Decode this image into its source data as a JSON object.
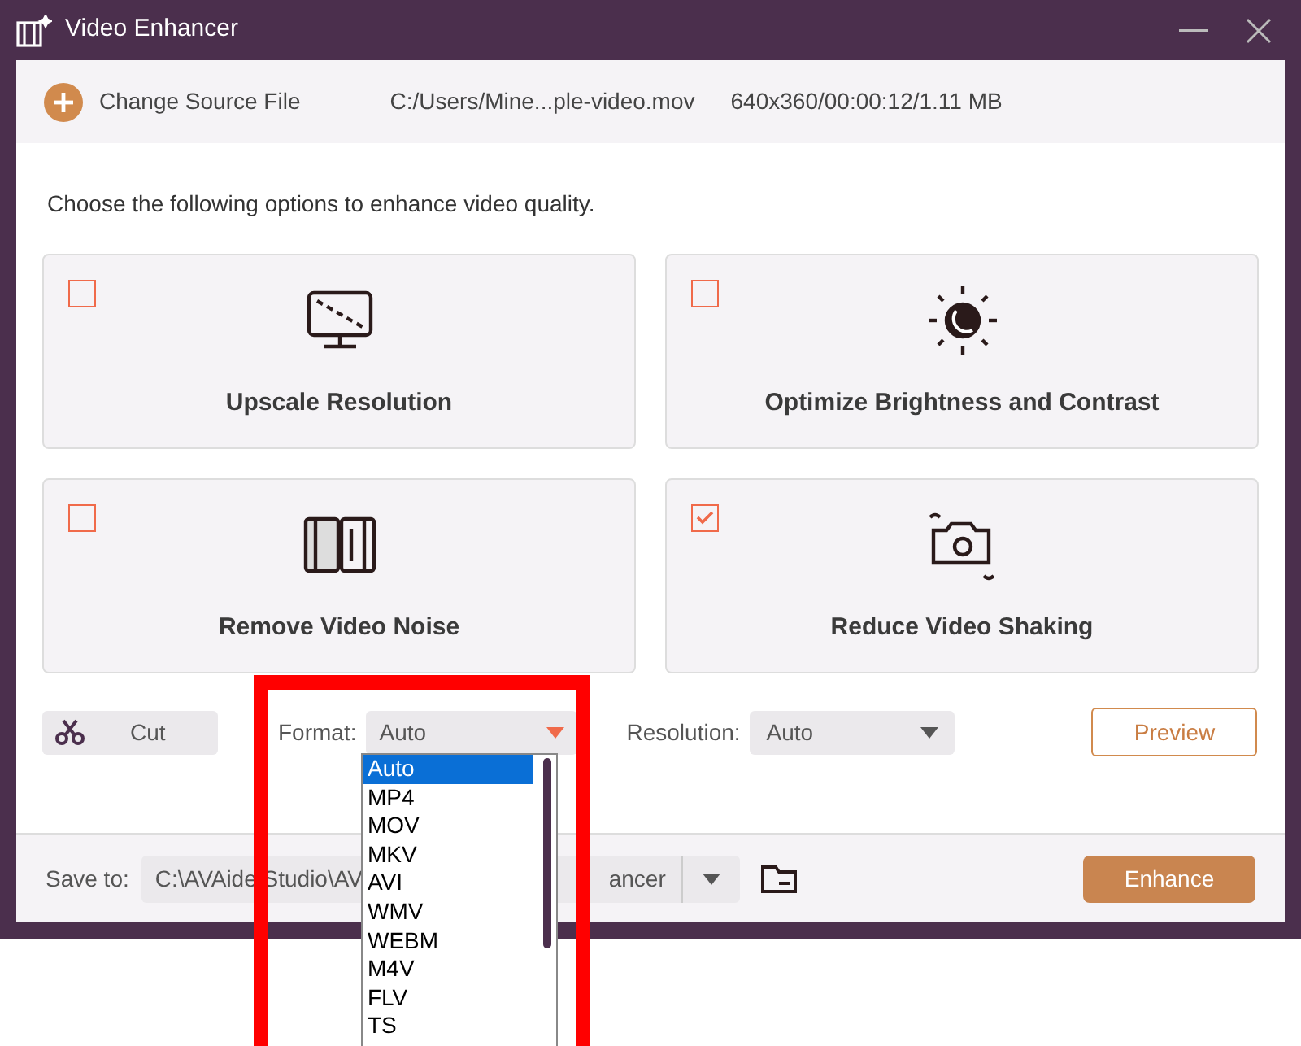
{
  "window": {
    "title": "Video Enhancer"
  },
  "source": {
    "button": "Change Source File",
    "path": "C:/Users/Mine...ple-video.mov",
    "info": "640x360/00:00:12/1.11 MB"
  },
  "instructions": "Choose the following options to enhance video quality.",
  "options": [
    {
      "kind": "upscale",
      "label": "Upscale Resolution",
      "checked": false
    },
    {
      "kind": "brightness",
      "label": "Optimize Brightness and Contrast",
      "checked": false
    },
    {
      "kind": "noise",
      "label": "Remove Video Noise",
      "checked": false
    },
    {
      "kind": "shaking",
      "label": "Reduce Video Shaking",
      "checked": true
    }
  ],
  "cut_button": "Cut",
  "format": {
    "label": "Format:",
    "value": "Auto",
    "expanded": true,
    "options": [
      {
        "label": "Auto",
        "selected": true
      },
      {
        "label": "MP4",
        "selected": false
      },
      {
        "label": "MOV",
        "selected": false
      },
      {
        "label": "MKV",
        "selected": false
      },
      {
        "label": "AVI",
        "selected": false
      },
      {
        "label": "WMV",
        "selected": false
      },
      {
        "label": "WEBM",
        "selected": false
      },
      {
        "label": "M4V",
        "selected": false
      },
      {
        "label": "FLV",
        "selected": false
      },
      {
        "label": "TS",
        "selected": false
      }
    ]
  },
  "resolution": {
    "label": "Resolution:",
    "value": "Auto"
  },
  "preview_button": "Preview",
  "save_to": {
    "label": "Save to:",
    "path_start": "C:\\AVAide Studio\\AV",
    "path_end": "ancer"
  },
  "enhance_button": "Enhance"
}
